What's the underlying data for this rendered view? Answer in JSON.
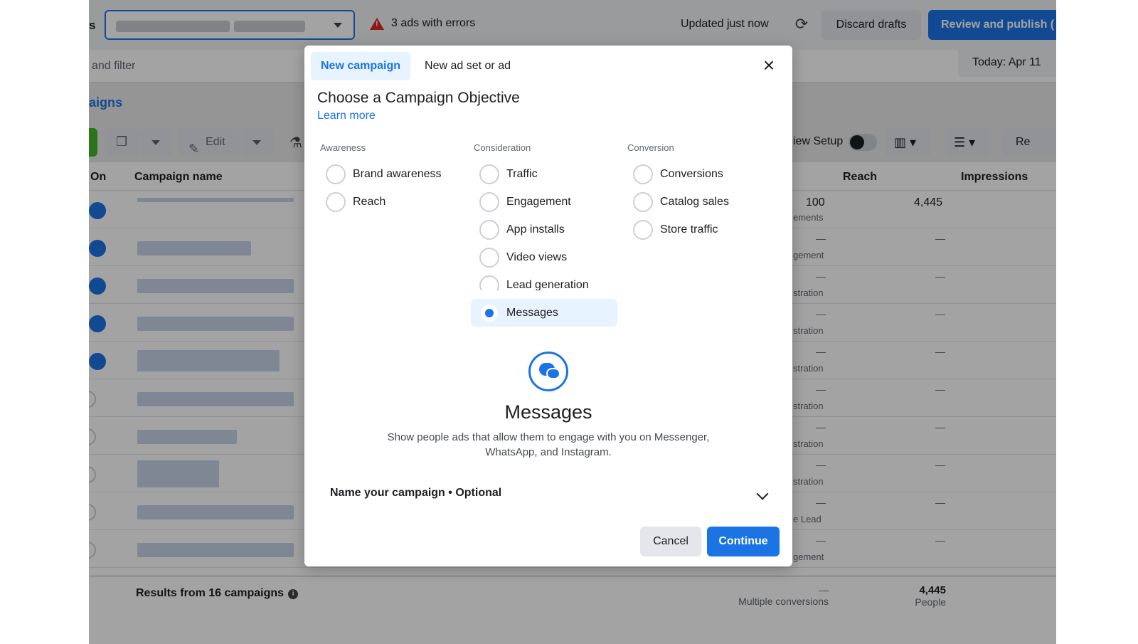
{
  "header": {
    "account_prefix": "s",
    "errors_text": "3 ads with errors",
    "updated_text": "Updated just now",
    "discard_label": "Discard drafts",
    "review_label": "Review and publish (",
    "search_text": "and filter",
    "date_label": "Today: Apr 11",
    "section_title": "aigns"
  },
  "toolbar": {
    "edit_label": "Edit",
    "view_setup_label": "iew Setup",
    "reports_label": "Re"
  },
  "table": {
    "columns": {
      "on": "On",
      "name": "Campaign name",
      "reach": "Reach",
      "impressions": "Impressions"
    },
    "first_row": {
      "results": "100",
      "results_sub": "ements",
      "reach": "4,445"
    },
    "row_subs": [
      "gement",
      "stration",
      "stration",
      "stration",
      "stration",
      "stration",
      "stration",
      "e Lead",
      "gement"
    ],
    "dash": "—",
    "footer": {
      "results_text": "Results from 16 campaigns",
      "multiple_conversions": "Multiple conversions",
      "reach_total": "4,445",
      "reach_unit": "People",
      "dash": "—"
    }
  },
  "modal": {
    "tabs": [
      {
        "label": "New campaign"
      },
      {
        "label": "New ad set or ad"
      }
    ],
    "title": "Choose a Campaign Objective",
    "learn_more": "Learn more",
    "groups": [
      {
        "heading": "Awareness",
        "options": [
          "Brand awareness",
          "Reach"
        ]
      },
      {
        "heading": "Consideration",
        "options": [
          "Traffic",
          "Engagement",
          "App installs",
          "Video views",
          "Lead generation",
          "Messages"
        ]
      },
      {
        "heading": "Conversion",
        "options": [
          "Conversions",
          "Catalog sales",
          "Store traffic"
        ]
      }
    ],
    "selected_option": "Messages",
    "detail_title": "Messages",
    "detail_text": "Show people ads that allow them to engage with you on Messenger, WhatsApp, and Instagram.",
    "name_campaign": "Name your campaign • Optional",
    "cancel_label": "Cancel",
    "continue_label": "Continue"
  },
  "colors": {
    "accent": "#1b74e4",
    "error": "#e02424",
    "selected_bg": "#e7f3ff"
  },
  "icons": [
    "warning-icon",
    "refresh-icon",
    "close-icon",
    "messenger-chat-icon",
    "chevron-down-icon",
    "pencil-icon",
    "flask-icon",
    "columns-icon",
    "breakdown-icon"
  ]
}
